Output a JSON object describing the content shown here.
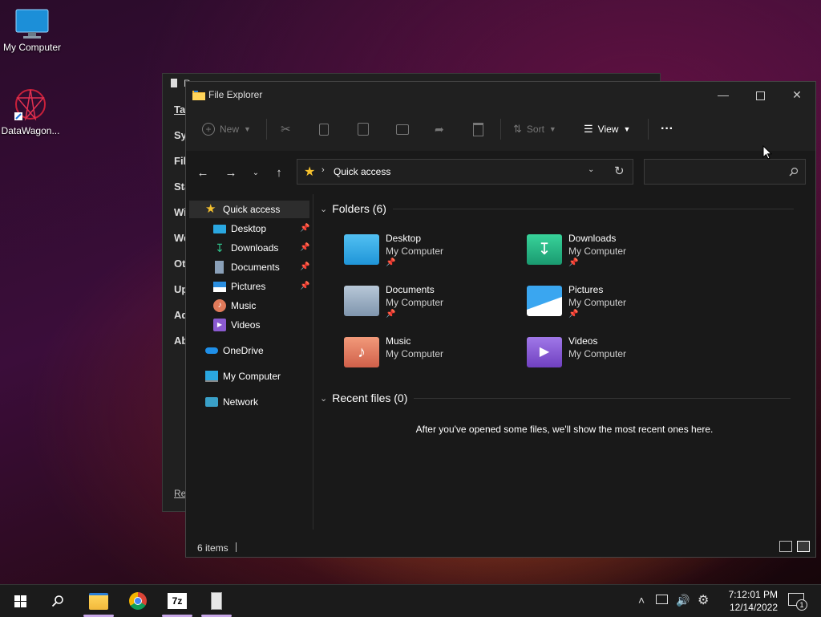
{
  "desktop": {
    "icons": [
      {
        "label": "My Computer",
        "icon": "monitor-icon"
      },
      {
        "label": "DataWagon...",
        "icon": "datawagon-icon"
      }
    ]
  },
  "background_window": {
    "title": "R",
    "items": [
      "Ta",
      "Sy",
      "Fil",
      "Sta",
      "Wi",
      "We",
      "Ot",
      "Up",
      "Ad",
      "Ab"
    ],
    "footer": "Re"
  },
  "explorer": {
    "title": "File Explorer",
    "toolbar": {
      "new_label": "New",
      "sort_label": "Sort",
      "view_label": "View",
      "more_label": "···"
    },
    "address": {
      "location": "Quick access"
    },
    "search": {
      "placeholder": ""
    },
    "sidebar": {
      "items": [
        {
          "label": "Quick access",
          "icon": "star-icon"
        },
        {
          "label": "Desktop",
          "icon": "desktop-icon"
        },
        {
          "label": "Downloads",
          "icon": "downloads-icon"
        },
        {
          "label": "Documents",
          "icon": "documents-icon"
        },
        {
          "label": "Pictures",
          "icon": "pictures-icon"
        },
        {
          "label": "Music",
          "icon": "music-icon"
        },
        {
          "label": "Videos",
          "icon": "videos-icon"
        },
        {
          "label": "OneDrive",
          "icon": "onedrive-icon"
        },
        {
          "label": "My Computer",
          "icon": "computer-icon"
        },
        {
          "label": "Network",
          "icon": "network-icon"
        }
      ]
    },
    "folders_header": "Folders (6)",
    "folders": [
      {
        "name": "Desktop",
        "location": "My Computer",
        "pinned": true,
        "color": "#2aa7e0"
      },
      {
        "name": "Downloads",
        "location": "My Computer",
        "pinned": true,
        "color": "#1fa37a"
      },
      {
        "name": "Documents",
        "location": "My Computer",
        "pinned": true,
        "color": "#8aa0b8"
      },
      {
        "name": "Pictures",
        "location": "My Computer",
        "pinned": true,
        "color": "#2a8ee0"
      },
      {
        "name": "Music",
        "location": "My Computer",
        "pinned": false,
        "color": "#e07a5a"
      },
      {
        "name": "Videos",
        "location": "My Computer",
        "pinned": false,
        "color": "#8a5ad0"
      }
    ],
    "recent_header": "Recent files (0)",
    "recent_empty_message": "After you've opened some files, we'll show the most recent ones here.",
    "status": {
      "item_count": "6 items"
    }
  },
  "taskbar": {
    "clock_time": "7:12:01 PM",
    "clock_date": "12/14/2022",
    "notification_count": "1",
    "apps": [
      "file-explorer-icon",
      "chrome-icon",
      "7zip-icon",
      "system-info-icon"
    ],
    "seven_zip_label": "7z"
  }
}
